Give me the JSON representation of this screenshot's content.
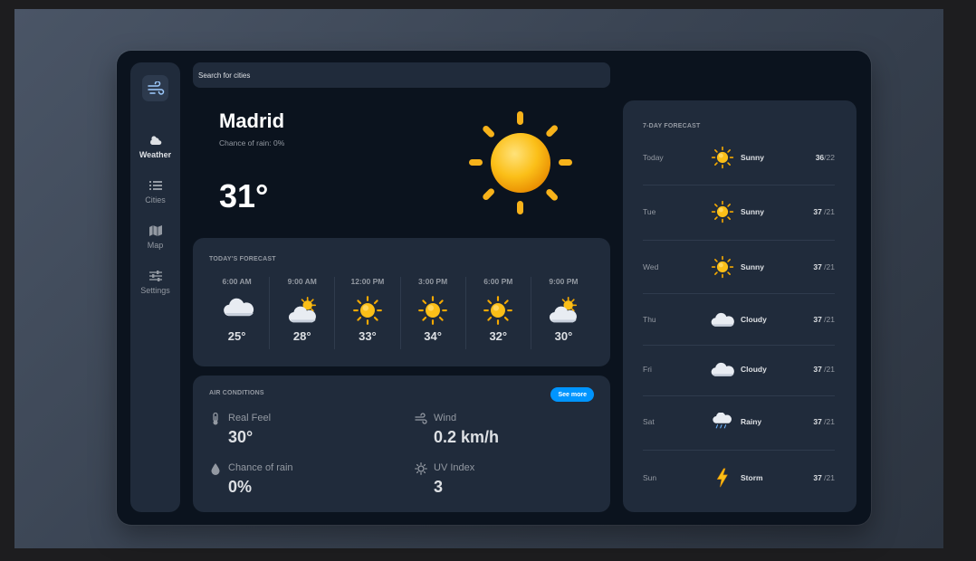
{
  "search": {
    "placeholder": "Search for cities"
  },
  "sidebar": {
    "items": [
      {
        "label": "Weather",
        "icon": "cloud-sun-icon",
        "active": true
      },
      {
        "label": "Cities",
        "icon": "list-icon"
      },
      {
        "label": "Map",
        "icon": "map-icon"
      },
      {
        "label": "Settings",
        "icon": "sliders-icon"
      }
    ]
  },
  "current": {
    "city": "Madrid",
    "subtitle": "Chance of rain: 0%",
    "temperature": "31°",
    "icon": "sun-icon"
  },
  "today": {
    "title": "TODAY'S FORECAST",
    "hours": [
      {
        "time": "6:00 AM",
        "temp": "25°",
        "icon": "cloud-icon"
      },
      {
        "time": "9:00 AM",
        "temp": "28°",
        "icon": "partly-cloudy-icon"
      },
      {
        "time": "12:00 PM",
        "temp": "33°",
        "icon": "sun-icon"
      },
      {
        "time": "3:00 PM",
        "temp": "34°",
        "icon": "sun-icon"
      },
      {
        "time": "6:00 PM",
        "temp": "32°",
        "icon": "sun-icon"
      },
      {
        "time": "9:00 PM",
        "temp": "30°",
        "icon": "partly-cloudy-icon"
      }
    ]
  },
  "air": {
    "title": "AIR CONDITIONS",
    "see_more": "See more",
    "real_feel": {
      "label": "Real Feel",
      "value": "30°"
    },
    "wind": {
      "label": "Wind",
      "value": "0.2 km/h"
    },
    "rain": {
      "label": "Chance of rain",
      "value": "0%"
    },
    "uv": {
      "label": "UV Index",
      "value": "3"
    }
  },
  "week": {
    "title": "7-DAY FORECAST",
    "days": [
      {
        "day": "Today",
        "condition": "Sunny",
        "high": "36",
        "low": "/22",
        "icon": "sun-icon"
      },
      {
        "day": "Tue",
        "condition": "Sunny",
        "high": "37",
        "low": " /21",
        "icon": "sun-icon"
      },
      {
        "day": "Wed",
        "condition": "Sunny",
        "high": "37",
        "low": " /21",
        "icon": "sun-icon"
      },
      {
        "day": "Thu",
        "condition": "Cloudy",
        "high": "37",
        "low": " /21",
        "icon": "cloud-icon"
      },
      {
        "day": "Fri",
        "condition": "Cloudy",
        "high": "37",
        "low": " /21",
        "icon": "cloud-icon"
      },
      {
        "day": "Sat",
        "condition": "Rainy",
        "high": "37",
        "low": " /21",
        "icon": "rain-cloud-icon"
      },
      {
        "day": "Sun",
        "condition": "Storm",
        "high": "37",
        "low": " /21",
        "icon": "lightning-icon"
      }
    ]
  },
  "colors": {
    "background": "#0b131e",
    "panel": "#202b3b",
    "accent": "#0095ff",
    "sun": "#f5b400",
    "text": "#dde0e4",
    "muted": "#9399a2"
  }
}
